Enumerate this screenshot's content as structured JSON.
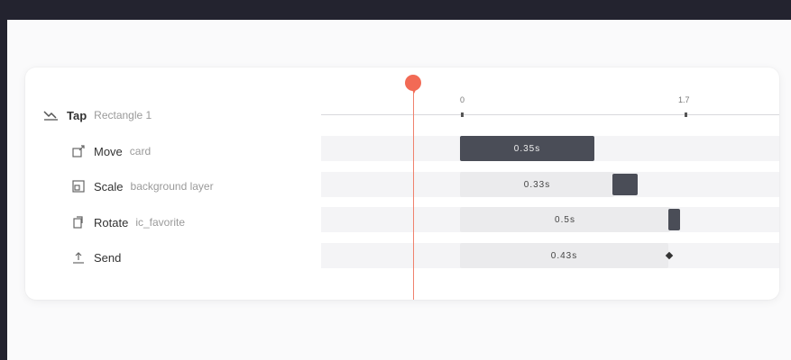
{
  "window": {
    "background": "#23232f",
    "accent": "#f26a55"
  },
  "timeline": {
    "ticks": [
      "0",
      "1.7"
    ],
    "rows": [
      {
        "verb": "Tap",
        "object": "Rectangle 1",
        "icon": "tap-trigger-icon"
      },
      {
        "verb": "Move",
        "object": "card",
        "icon": "move-icon",
        "duration_label": "0.35s"
      },
      {
        "verb": "Scale",
        "object": "background layer",
        "icon": "scale-icon",
        "duration_label": "0.33s"
      },
      {
        "verb": "Rotate",
        "object": "ic_favorite",
        "icon": "rotate-icon",
        "duration_label": "0.5s"
      },
      {
        "verb": "Send",
        "object": "",
        "icon": "send-icon",
        "duration_label": "0.43s"
      }
    ]
  }
}
